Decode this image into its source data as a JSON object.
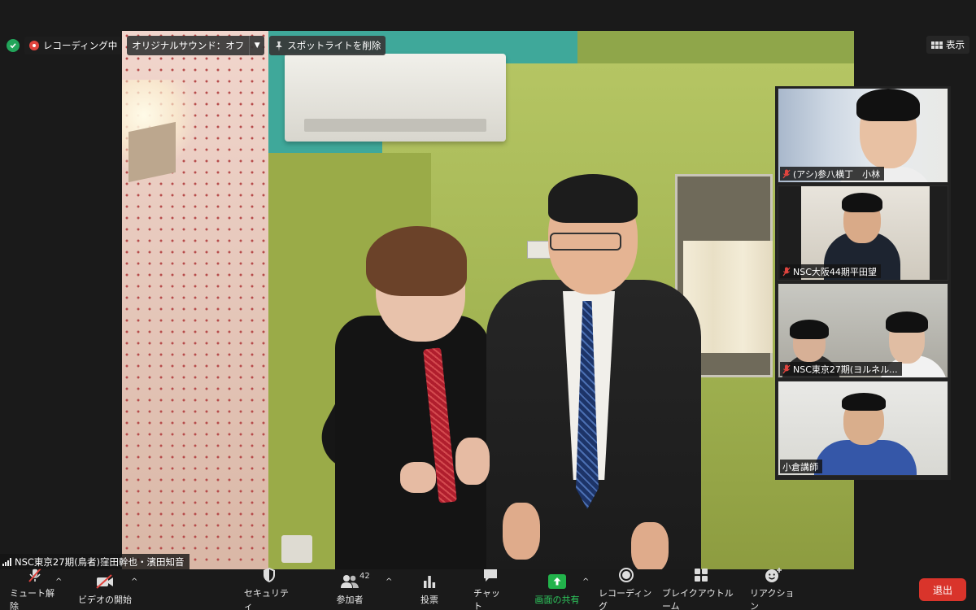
{
  "status": {
    "recording_label": "レコーディング中",
    "original_sound_label": "オリジナルサウンド：オフ",
    "spotlight_remove_label": "スポットライトを削除",
    "view_label": "表示"
  },
  "main_video": {
    "name": "NSC東京27期(鳥者)窪田幹也・濱田知音"
  },
  "participants": [
    {
      "name": "(アシ)参八横丁　小林",
      "muted": true
    },
    {
      "name": "NSC大阪44期平田望",
      "muted": true
    },
    {
      "name": "NSC東京27期(ヨルネル...",
      "muted": true
    },
    {
      "name": "小倉講師",
      "muted": false
    }
  ],
  "toolbar": {
    "mute_label": "ミュート解除",
    "video_label": "ビデオの開始",
    "security_label": "セキュリティ",
    "participants_label": "参加者",
    "participants_count": "42",
    "polls_label": "投票",
    "chat_label": "チャット",
    "share_label": "画面の共有",
    "record_label": "レコーディング",
    "breakout_label": "ブレイクアウトルーム",
    "reactions_label": "リアクション",
    "leave_label": "退出"
  },
  "colors": {
    "share_green": "#22b34b",
    "leave_red": "#d9342b",
    "recording_red": "#e0443e",
    "secure_green": "#22a55a",
    "muted_red": "#e0443e"
  }
}
